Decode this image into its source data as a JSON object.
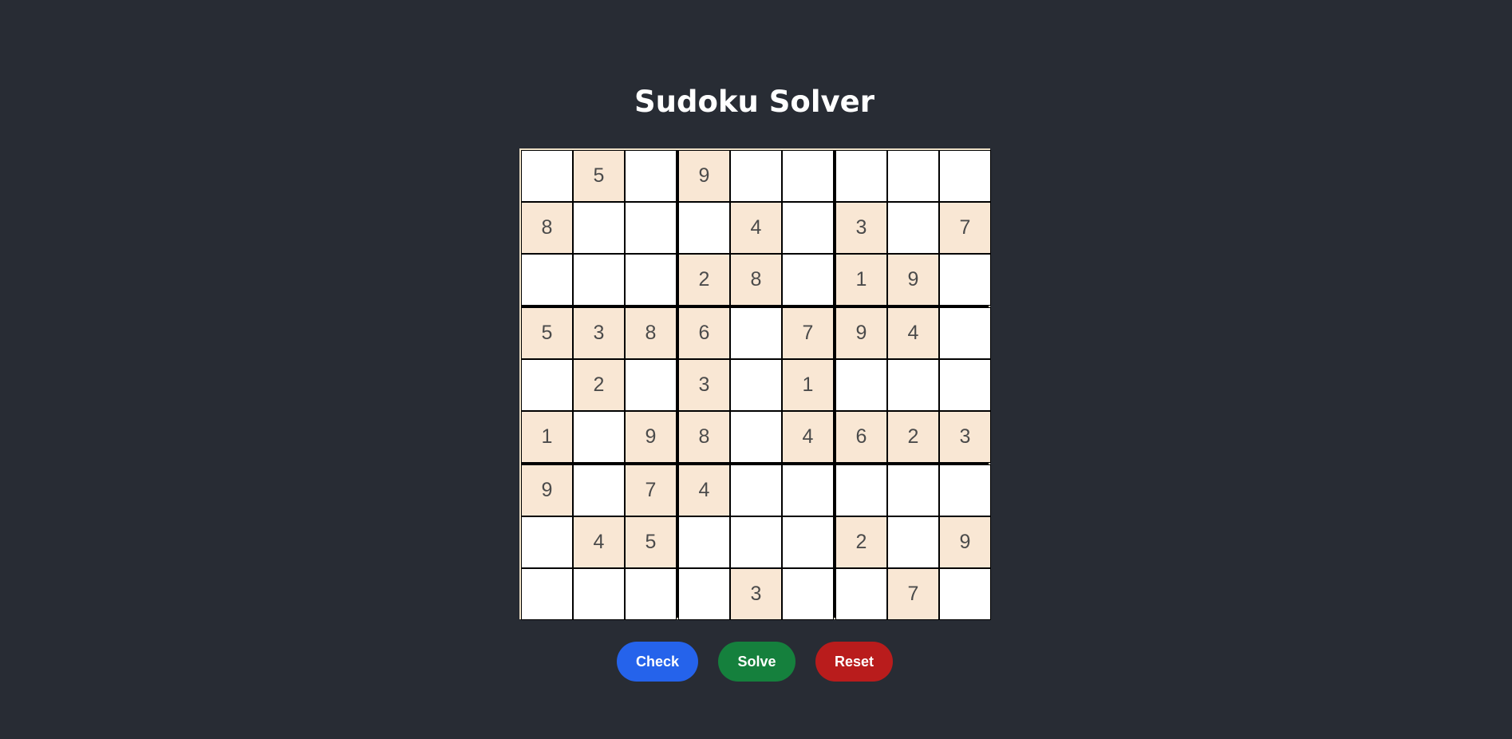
{
  "title": "Sudoku Solver",
  "colors": {
    "background": "#282c34",
    "given_cell": "#f9e7d4",
    "empty_cell": "#ffffff",
    "check": "#2563eb",
    "solve": "#15803d",
    "reset": "#b91c1c"
  },
  "grid": [
    [
      0,
      5,
      0,
      9,
      0,
      0,
      0,
      0,
      0
    ],
    [
      8,
      0,
      0,
      0,
      4,
      0,
      3,
      0,
      7
    ],
    [
      0,
      0,
      0,
      2,
      8,
      0,
      1,
      9,
      0
    ],
    [
      5,
      3,
      8,
      6,
      0,
      7,
      9,
      4,
      0
    ],
    [
      0,
      2,
      0,
      3,
      0,
      1,
      0,
      0,
      0
    ],
    [
      1,
      0,
      9,
      8,
      0,
      4,
      6,
      2,
      3
    ],
    [
      9,
      0,
      7,
      4,
      0,
      0,
      0,
      0,
      0
    ],
    [
      0,
      4,
      5,
      0,
      0,
      0,
      2,
      0,
      9
    ],
    [
      0,
      0,
      0,
      0,
      3,
      0,
      0,
      7,
      0
    ]
  ],
  "buttons": {
    "check": "Check",
    "solve": "Solve",
    "reset": "Reset"
  }
}
